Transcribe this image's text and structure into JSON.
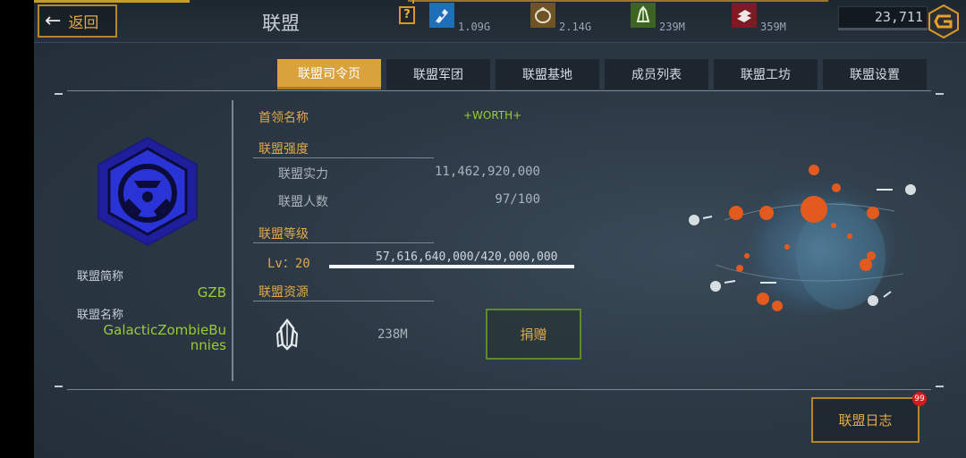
{
  "header": {
    "back_label": "返回",
    "title": "联盟",
    "help_label": "?",
    "resources": [
      {
        "icon": "blue-chip-icon",
        "value": "1.09G",
        "color": "#1e6fb8"
      },
      {
        "icon": "orange-ore-icon",
        "value": "2.14G",
        "color": "#8a6a2a"
      },
      {
        "icon": "green-crystal-icon",
        "value": "239M",
        "color": "#4c7a2a"
      },
      {
        "icon": "red-bars-icon",
        "value": "359M",
        "color": "#9a1e2a"
      }
    ],
    "coins": "23,711"
  },
  "tabs": [
    {
      "label": "联盟司令页",
      "active": true
    },
    {
      "label": "联盟军团"
    },
    {
      "label": "联盟基地"
    },
    {
      "label": "成员列表"
    },
    {
      "label": "联盟工坊"
    },
    {
      "label": "联盟设置"
    }
  ],
  "left": {
    "abbr_label": "联盟简称",
    "abbr_value": "GZB",
    "name_label": "联盟名称",
    "name_value_line1": "GalacticZombieBu",
    "name_value_line2": "nnies"
  },
  "info": {
    "leader_label": "首领名称",
    "leader_value": "+WORTH+",
    "strength_title": "联盟强度",
    "power_label": "联盟实力",
    "power_value": "11,462,920,000",
    "members_label": "联盟人数",
    "members_value": "97/100",
    "level_title": "联盟等级",
    "level_value": "Lv：20",
    "exp_text": "57,616,640,000/420,000,000",
    "exp_progress": 1.0,
    "resource_title": "联盟资源",
    "resource_value": "238M",
    "donate_label": "捐赠"
  },
  "footer": {
    "log_label": "联盟日志",
    "log_badge": "99"
  },
  "colors": {
    "accent": "#e0a84a",
    "gold": "#d9a23c",
    "green": "#9acd32",
    "badge": "#d21c1c"
  }
}
